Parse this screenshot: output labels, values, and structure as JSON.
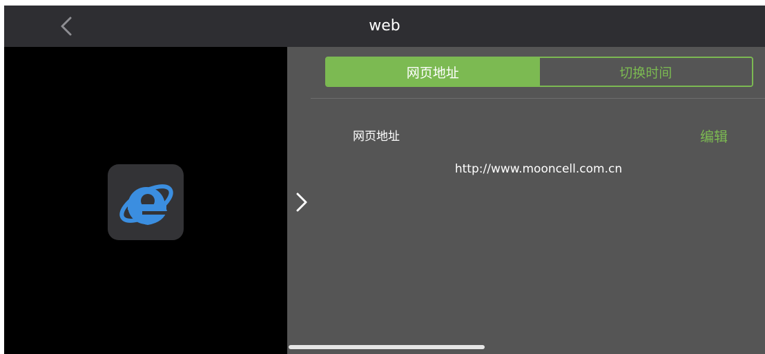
{
  "header": {
    "title": "web",
    "back_icon": "chevron-left-icon"
  },
  "preview": {
    "app_icon": "internet-explorer-icon",
    "expand_icon": "chevron-right-icon"
  },
  "tabs": [
    {
      "label": "网页地址",
      "active": true
    },
    {
      "label": "切换时间",
      "active": false
    }
  ],
  "settings": {
    "field_label": "网页地址",
    "edit_label": "编辑",
    "url_value": "http://www.mooncell.com.cn"
  },
  "colors": {
    "accent": "#7cba52",
    "header_bg": "#2e2e32",
    "panel_bg": "#555555",
    "preview_bg": "#000000"
  }
}
